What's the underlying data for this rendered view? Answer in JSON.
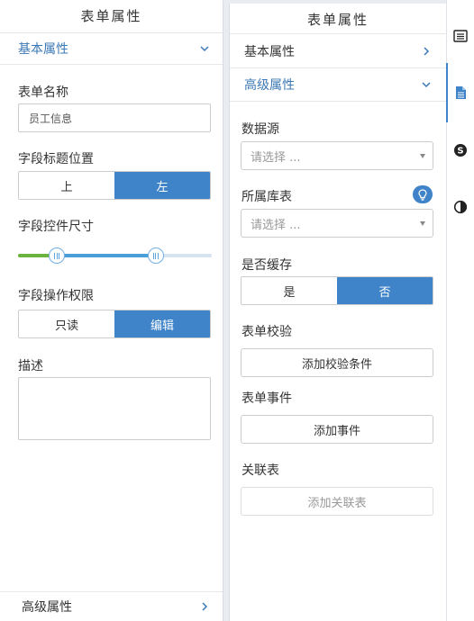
{
  "left_panel": {
    "title": "表单属性",
    "basic_section": "基本属性",
    "form_name_label": "表单名称",
    "form_name_value": "员工信息",
    "label_position_label": "字段标题位置",
    "label_position_options": [
      "上",
      "左"
    ],
    "label_position_selected": "左",
    "control_size_label": "字段控件尺寸",
    "control_size_range": {
      "low": 0.2,
      "high": 0.71
    },
    "permission_label": "字段操作权限",
    "permission_options": [
      "只读",
      "编辑"
    ],
    "permission_selected": "编辑",
    "description_label": "描述",
    "description_value": "",
    "advanced_section": "高级属性"
  },
  "right_panel": {
    "title": "表单属性",
    "basic_section": "基本属性",
    "advanced_section": "高级属性",
    "datasource_label": "数据源",
    "datasource_placeholder": "请选择 ...",
    "library_label": "所属库表",
    "library_placeholder": "请选择 ...",
    "cache_label": "是否缓存",
    "cache_options": [
      "是",
      "否"
    ],
    "cache_selected": "否",
    "validation_label": "表单校验",
    "validation_button": "添加校验条件",
    "events_label": "表单事件",
    "events_button": "添加事件",
    "related_label": "关联表",
    "related_button": "添加关联表"
  },
  "sidebar": {
    "icons": [
      "list-panel-icon",
      "document-icon",
      "skype-icon",
      "contrast-icon"
    ],
    "active": "document-icon"
  },
  "colors": {
    "accent": "#3f83c9",
    "slider_green": "#6db33f",
    "slider_blue": "#4a9fd8"
  }
}
